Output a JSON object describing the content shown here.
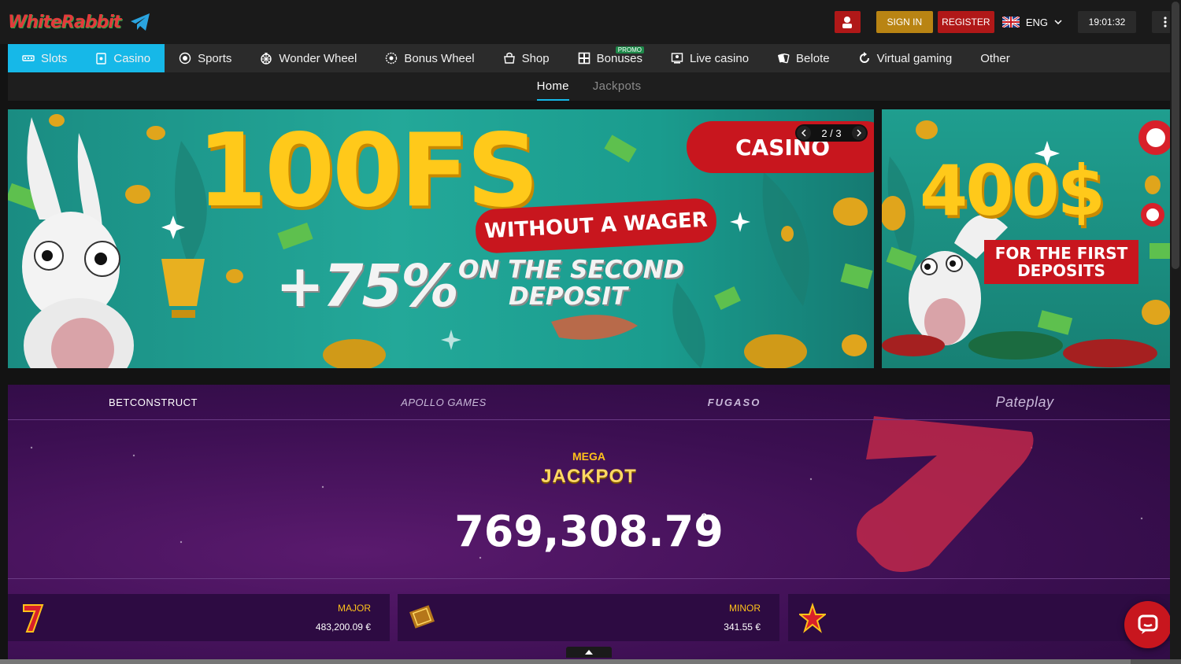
{
  "brand": {
    "logo_text": "WhiteRabbit",
    "telegram_icon": "telegram-icon"
  },
  "header": {
    "sign_in_label": "SIGN IN",
    "register_label": "REGISTER",
    "language": "ENG",
    "time": "19:01:32"
  },
  "nav": {
    "items": [
      {
        "label": "Slots",
        "icon": "slots-icon"
      },
      {
        "label": "Casino",
        "icon": "cards-icon"
      },
      {
        "label": "Sports",
        "icon": "ball-icon"
      },
      {
        "label": "Wonder Wheel",
        "icon": "wheel-icon"
      },
      {
        "label": "Bonus Wheel",
        "icon": "gear-wheel-icon"
      },
      {
        "label": "Shop",
        "icon": "shop-icon"
      },
      {
        "label": "Bonuses",
        "icon": "gift-icon",
        "badge": "PROMO"
      },
      {
        "label": "Live casino",
        "icon": "tv-icon"
      },
      {
        "label": "Belote",
        "icon": "cards-fan-icon"
      },
      {
        "label": "Virtual gaming",
        "icon": "refresh-icon"
      },
      {
        "label": "Other",
        "icon": ""
      }
    ]
  },
  "subnav": {
    "home": "Home",
    "jackpots": "Jackpots"
  },
  "banner_main": {
    "headline": "100FS",
    "wager_pill": "WITHOUT A WAGER",
    "percent": "+75%",
    "deposit_line1": "ON THE SECOND",
    "deposit_line2": "DEPOSIT",
    "category_pill": "CASINO",
    "pager": "2 / 3"
  },
  "banner_side": {
    "headline": "400$",
    "line1": "FOR THE FIRST",
    "line2": "DEPOSITS"
  },
  "jackpot": {
    "providers": [
      "BETCONSTRUCT",
      "APOLLO GAMES",
      "FUGASO",
      "Pateplay"
    ],
    "mega_label": "MEGA",
    "title": "JACKPOT",
    "amount": "769,308.79",
    "currency": "€",
    "cards": [
      {
        "label": "MAJOR",
        "value": "483,200.09 €"
      },
      {
        "label": "MINOR",
        "value": "341.55 €"
      }
    ]
  },
  "colors": {
    "accent": "#16b8e8",
    "red": "#c8161e",
    "gold": "#b98413",
    "jackpot_bg": "#3c0f52"
  }
}
